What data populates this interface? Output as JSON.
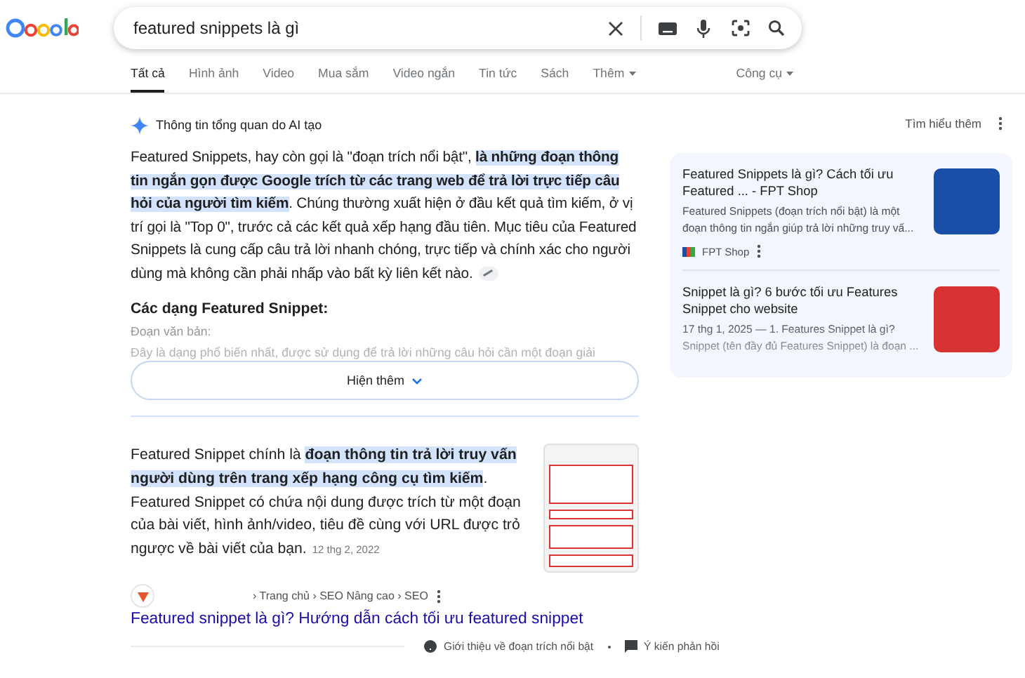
{
  "search": {
    "value": "featured snippets là gì"
  },
  "tabs": [
    {
      "label": "Tất cả",
      "selected": true
    },
    {
      "label": "Hình ảnh",
      "selected": false
    },
    {
      "label": "Video",
      "selected": false
    },
    {
      "label": "Mua sắm",
      "selected": false
    },
    {
      "label": "Video ngắn",
      "selected": false
    },
    {
      "label": "Tin tức",
      "selected": false
    },
    {
      "label": "Sách",
      "selected": false
    },
    {
      "label": "Thêm",
      "selected": false,
      "dropdown": true
    }
  ],
  "tools": {
    "label": "Công cụ"
  },
  "ai_overview": {
    "heading": "Thông tin tổng quan do AI tạo",
    "paragraph": "Featured Snippets, hay còn gọi là \"đoạn trích nổi bật\", **là những đoạn thông tin ngắn gọn được Google trích từ các trang web để trả lời trực tiếp câu hỏi của người tìm kiếm**. Chúng thường xuất hiện ở đầu kết quả tìm kiếm, ở vị trí gọi là \"Top 0\", trước cả các kết quả xếp hạng đầu tiên. Mục tiêu của Featured Snippets là cung cấp câu trả lời nhanh chóng, trực tiếp và chính xác cho người dùng mà không cần phải nhấp vào bất kỳ liên kết nào.",
    "subheading": "Các dạng Featured Snippet:",
    "faded_lines": [
      "Đoạn văn bản:",
      "Đây là dạng phổ biến nhất, được sử dụng để trả lời những câu hỏi cần một đoạn giải"
    ],
    "show_more": "Hiện thêm",
    "learn_more": "Tìm hiểu thêm",
    "sources": [
      {
        "title": "Featured Snippets là gì? Cách tối ưu Featured ... - FPT Shop",
        "snippet": "Featured Snippets (đoạn trích nổi bật) là một đoạn thông tin ngắn giúp trả lời những truy vấ...",
        "site": "FPT Shop",
        "color": "#1a4fa8"
      },
      {
        "title": "Snippet là gì? 6 bước tối ưu Features Snippet cho website",
        "snippet": "17 thg 1, 2025 — 1. Features Snippet là gì? Snippet (tên đầy đủ Features Snippet) là đoạn ...",
        "color": "#d83232"
      }
    ]
  },
  "featured_snippet": {
    "paragraph": "Featured Snippet chính là **đoạn thông tin trả lời truy vấn người dùng trên trang xếp hạng công cụ tìm kiếm**. Featured Snippet có chứa nội dung được trích từ một đoạn của bài viết, hình ảnh/video, tiêu đề cùng với URL được trỏ ngược về bài viết của bạn.",
    "date": "12 thg 2, 2022",
    "breadcrumb": "› Trang chủ › SEO Nâng cao › SEO",
    "link_title": "Featured snippet là gì? Hướng dẫn cách tối ưu featured snippet",
    "about": "Giới thiệu về đoạn trích nổi bật",
    "feedback": "Ý kiến phản hồi"
  }
}
